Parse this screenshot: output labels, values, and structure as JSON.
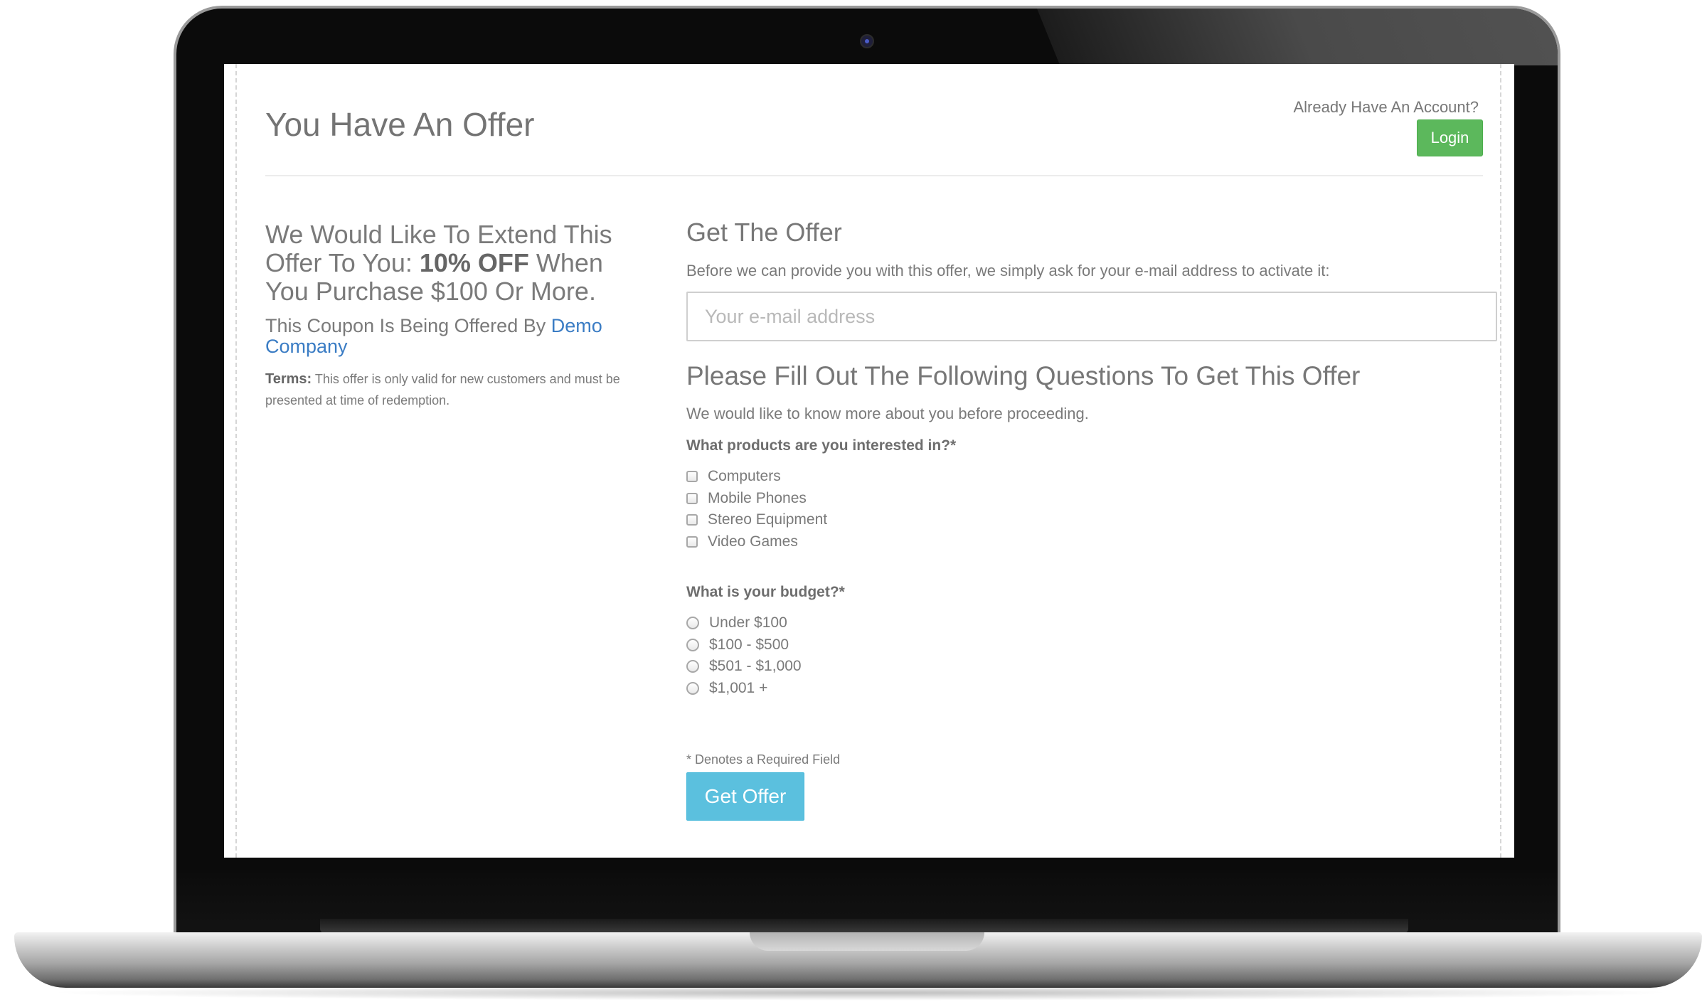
{
  "header": {
    "title": "You Have An Offer",
    "account_prompt": "Already Have An Account?",
    "login_label": "Login"
  },
  "offer": {
    "headline_before": "We Would Like To Extend This Offer To You: ",
    "headline_bold": "10% OFF",
    "headline_after": " When You Purchase $100 Or More.",
    "offered_by_prefix": "This Coupon Is Being Offered By ",
    "company_name": "Demo Company",
    "terms_label": "Terms:",
    "terms_text": " This offer is only valid for new customers and must be presented at time of redemption."
  },
  "form": {
    "get_offer_title": "Get The Offer",
    "email_description": "Before we can provide you with this offer, we simply ask for your e-mail address to activate it:",
    "email_placeholder": "Your e-mail address",
    "questions_title": "Please Fill Out The Following Questions To Get This Offer",
    "questions_description": "We would like to know more about you before proceeding.",
    "products_question": "What products are you interested in?*",
    "products_options": [
      "Computers",
      "Mobile Phones",
      "Stereo Equipment",
      "Video Games"
    ],
    "budget_question": "What is your budget?*",
    "budget_options": [
      "Under $100",
      "$100 - $500",
      "$501 - $1,000",
      "$1,001 +"
    ],
    "required_note": "* Denotes a Required Field",
    "submit_label": "Get Offer"
  },
  "colors": {
    "login_button": "#5cb85c",
    "submit_button": "#5bc0de",
    "link": "#3a7cc4"
  }
}
